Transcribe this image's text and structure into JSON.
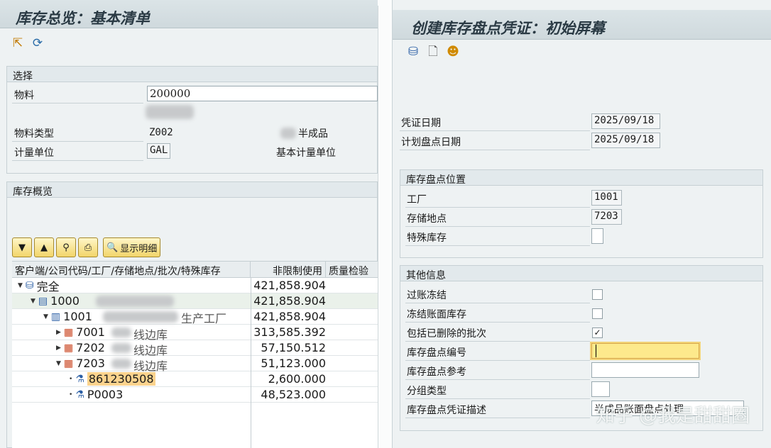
{
  "left_window": {
    "title": "库存总览：基本清单",
    "selection": {
      "header": "选择",
      "material_label": "物料",
      "material_value": "200000",
      "material_type_label": "物料类型",
      "material_type_value": "Z002",
      "material_type_desc": "半成品",
      "uom_label": "计量单位",
      "uom_value": "GAL",
      "uom_desc": "基本计量单位"
    },
    "overview_header": "库存概览",
    "detail_button": "显示明细",
    "columns": [
      "客户端/公司代码/工厂/存储地点/批次/特殊库存",
      "非限制使用",
      "质量检验"
    ],
    "rows": [
      {
        "label": "完全",
        "value": "421,858.904"
      },
      {
        "label": "1000",
        "value": "421,858.904"
      },
      {
        "label": "1001",
        "suffix": "生产工厂",
        "value": "421,858.904"
      },
      {
        "label": "7001",
        "suffix": "线边库",
        "value": "313,585.392"
      },
      {
        "label": "7202",
        "suffix": "线边库",
        "value": "57,150.512"
      },
      {
        "label": "7203",
        "suffix": "线边库",
        "value": "51,123.000"
      },
      {
        "label": "861230508",
        "value": "2,600.000"
      },
      {
        "label": "P0003",
        "value": "48,523.000"
      }
    ]
  },
  "right_window": {
    "title": "创建库存盘点凭证：初始屏幕",
    "doc_date_label": "凭证日期",
    "doc_date_value": "2025/09/18",
    "plan_date_label": "计划盘点日期",
    "plan_date_value": "2025/09/18",
    "location_header": "库存盘点位置",
    "plant_label": "工厂",
    "plant_value": "1001",
    "sloc_label": "存储地点",
    "sloc_value": "7203",
    "special_label": "特殊库存",
    "other_header": "其他信息",
    "posting_block_label": "过账冻结",
    "freeze_label": "冻结账面库存",
    "deleted_batches_label": "包括已删除的批次",
    "deleted_batches_mark": "✓",
    "pi_number_label": "库存盘点编号",
    "pi_ref_label": "库存盘点参考",
    "group_type_label": "分组类型",
    "desc_label": "库存盘点凭证描述",
    "desc_value": "半成品账面盘点处理"
  },
  "watermark": "知乎 @我是甜甜圈"
}
